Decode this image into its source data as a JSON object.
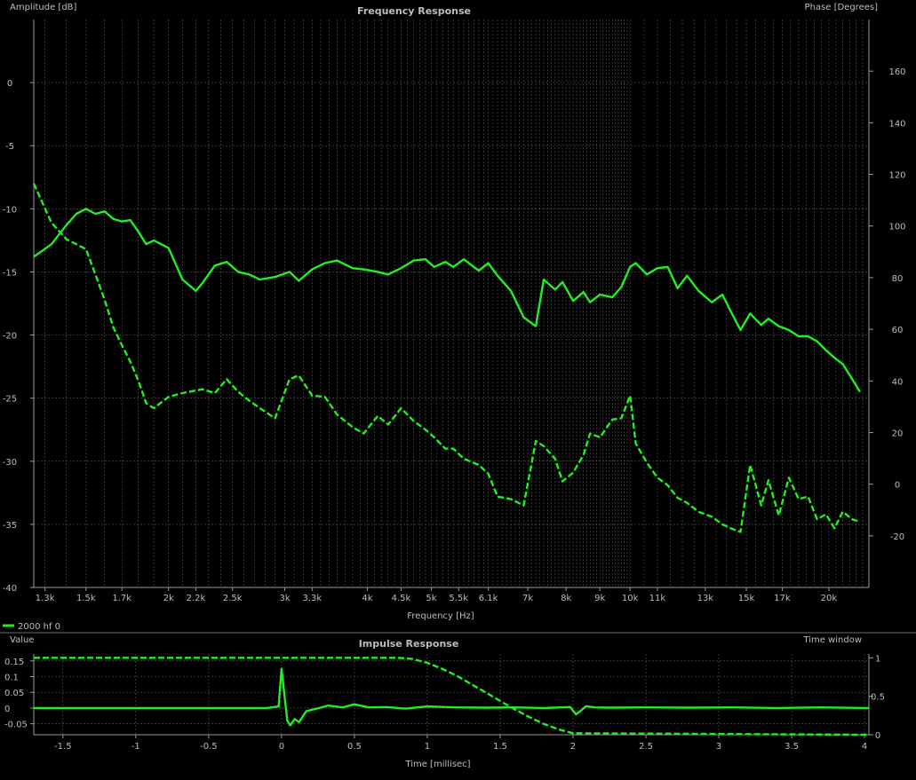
{
  "colors": {
    "background": "#000000",
    "grid": "#5a5a5a",
    "axis": "#9a9a9a",
    "text": "#bdbdbd",
    "trace": "#22ee22"
  },
  "legend": {
    "label": "2000 hf 0"
  },
  "chart_data": [
    {
      "type": "line",
      "title": "Frequency Response",
      "xlabel": "Frequency [Hz]",
      "ylabel": "Amplitude [dB]",
      "y2label": "Phase [Degrees]",
      "x_scale": "log",
      "xlim": [
        1250,
        23000
      ],
      "ylim": [
        -40,
        5
      ],
      "y2lim": [
        -40,
        180
      ],
      "grid": true,
      "legend_position": "bottom-left",
      "x_ticks": [
        {
          "v": 1300,
          "label": "1.3k"
        },
        {
          "v": 1500,
          "label": "1.5k"
        },
        {
          "v": 1700,
          "label": "1.7k"
        },
        {
          "v": 2000,
          "label": "2k"
        },
        {
          "v": 2200,
          "label": "2.2k"
        },
        {
          "v": 2500,
          "label": "2.5k"
        },
        {
          "v": 3000,
          "label": "3k"
        },
        {
          "v": 3300,
          "label": "3.3k"
        },
        {
          "v": 4000,
          "label": "4k"
        },
        {
          "v": 4500,
          "label": "4.5k"
        },
        {
          "v": 5000,
          "label": "5k"
        },
        {
          "v": 5500,
          "label": "5.5k"
        },
        {
          "v": 6100,
          "label": "6.1k"
        },
        {
          "v": 7000,
          "label": "7k"
        },
        {
          "v": 8000,
          "label": "8k"
        },
        {
          "v": 9000,
          "label": "9k"
        },
        {
          "v": 10000,
          "label": "10k"
        },
        {
          "v": 11000,
          "label": "11k"
        },
        {
          "v": 13000,
          "label": "13k"
        },
        {
          "v": 15000,
          "label": "15k"
        },
        {
          "v": 17000,
          "label": "17k"
        },
        {
          "v": 20000,
          "label": "20k"
        }
      ],
      "y_ticks": [
        0,
        -5,
        -10,
        -15,
        -20,
        -25,
        -30,
        -35,
        -40
      ],
      "y2_ticks": [
        160,
        140,
        120,
        100,
        80,
        60,
        40,
        20,
        0,
        -20
      ],
      "series": [
        {
          "axis": "left",
          "style": "solid",
          "x": [
            1250,
            1330,
            1400,
            1450,
            1500,
            1550,
            1600,
            1650,
            1700,
            1750,
            1800,
            1850,
            1900,
            2000,
            2100,
            2200,
            2250,
            2350,
            2450,
            2550,
            2650,
            2750,
            2900,
            3050,
            3150,
            3300,
            3450,
            3600,
            3800,
            3950,
            4150,
            4300,
            4500,
            4700,
            4900,
            5050,
            5250,
            5400,
            5600,
            5900,
            6100,
            6300,
            6600,
            6900,
            7200,
            7400,
            7700,
            7900,
            8200,
            8500,
            8700,
            9000,
            9400,
            9700,
            10000,
            10200,
            10600,
            11000,
            11400,
            11800,
            12200,
            12700,
            13300,
            13800,
            14200,
            14700,
            15200,
            15800,
            16200,
            16800,
            17400,
            18000,
            18600,
            19200,
            19800,
            20400,
            21000,
            21700,
            22300
          ],
          "y": [
            -13.8,
            -12.8,
            -11.3,
            -10.4,
            -10.0,
            -10.4,
            -10.2,
            -10.8,
            -11.0,
            -10.9,
            -11.8,
            -12.8,
            -12.5,
            -13.1,
            -15.6,
            -16.5,
            -15.9,
            -14.5,
            -14.2,
            -15.0,
            -15.2,
            -15.6,
            -15.4,
            -15.0,
            -15.7,
            -14.8,
            -14.3,
            -14.1,
            -14.7,
            -14.8,
            -15.0,
            -15.2,
            -14.7,
            -14.1,
            -14.0,
            -14.6,
            -14.2,
            -14.6,
            -14.0,
            -14.9,
            -14.3,
            -15.3,
            -16.5,
            -18.6,
            -19.3,
            -15.6,
            -16.4,
            -15.8,
            -17.3,
            -16.6,
            -17.4,
            -16.8,
            -17.0,
            -16.2,
            -14.6,
            -14.3,
            -15.2,
            -14.7,
            -14.6,
            -16.3,
            -15.3,
            -16.5,
            -17.4,
            -16.8,
            -18.1,
            -19.6,
            -18.3,
            -19.2,
            -18.7,
            -19.3,
            -19.6,
            -20.1,
            -20.1,
            -20.5,
            -21.2,
            -21.8,
            -22.3,
            -23.5,
            -24.5
          ]
        },
        {
          "axis": "left",
          "style": "dashed",
          "x": [
            1250,
            1330,
            1400,
            1450,
            1500,
            1550,
            1600,
            1650,
            1700,
            1750,
            1800,
            1850,
            1900,
            2000,
            2100,
            2200,
            2250,
            2350,
            2450,
            2550,
            2650,
            2750,
            2900,
            3050,
            3150,
            3300,
            3450,
            3600,
            3800,
            3950,
            4150,
            4300,
            4500,
            4700,
            4900,
            5050,
            5250,
            5400,
            5600,
            5900,
            6100,
            6300,
            6600,
            6900,
            7200,
            7400,
            7700,
            7900,
            8200,
            8500,
            8700,
            9000,
            9400,
            9700,
            10000,
            10200,
            10600,
            11000,
            11400,
            11800,
            12200,
            12700,
            13300,
            13800,
            14200,
            14700,
            15200,
            15800,
            16200,
            16800,
            17400,
            18000,
            18600,
            19200,
            19800,
            20400,
            21000,
            21700,
            22300
          ],
          "y": [
            -8.0,
            -11.1,
            -12.4,
            -12.8,
            -13.2,
            -15.2,
            -17.2,
            -19.4,
            -20.8,
            -22.1,
            -23.6,
            -25.4,
            -25.8,
            -24.9,
            -24.6,
            -24.4,
            -24.3,
            -24.6,
            -23.5,
            -24.5,
            -25.2,
            -25.8,
            -26.6,
            -23.5,
            -23.2,
            -24.8,
            -24.9,
            -26.3,
            -27.3,
            -27.8,
            -26.4,
            -27.1,
            -25.8,
            -26.8,
            -27.5,
            -28.1,
            -29.0,
            -29.0,
            -29.8,
            -30.3,
            -31.0,
            -32.8,
            -33.0,
            -33.5,
            -28.4,
            -28.8,
            -29.8,
            -31.6,
            -30.9,
            -29.5,
            -27.8,
            -28.1,
            -26.7,
            -26.6,
            -24.8,
            -28.6,
            -30.1,
            -31.3,
            -31.9,
            -32.9,
            -33.3,
            -34.0,
            -34.4,
            -35.0,
            -35.3,
            -35.6,
            -30.3,
            -33.5,
            -31.5,
            -34.3,
            -31.3,
            -33.0,
            -32.8,
            -34.6,
            -34.2,
            -35.3,
            -34.0,
            -34.6,
            -34.8
          ]
        }
      ]
    },
    {
      "type": "line",
      "title": "Impulse Response",
      "xlabel": "Time [millisec]",
      "ylabel": "Value",
      "y2label": "Time window",
      "xlim": [
        -1.7,
        4.03
      ],
      "ylim": [
        -0.085,
        0.172
      ],
      "y2lim": [
        0,
        1.05
      ],
      "grid": true,
      "x_ticks": [
        -1.5,
        -1,
        -0.5,
        0,
        0.5,
        1,
        1.5,
        2,
        2.5,
        3,
        3.5,
        4
      ],
      "y_ticks": [
        0.15,
        0.1,
        0.05,
        0,
        -0.05
      ],
      "y2_ticks": [
        1,
        0.5,
        0
      ],
      "series": [
        {
          "axis": "left",
          "style": "solid",
          "x": [
            -1.7,
            -0.1,
            -0.02,
            0.0,
            0.02,
            0.04,
            0.06,
            0.09,
            0.12,
            0.17,
            0.24,
            0.32,
            0.42,
            0.5,
            0.6,
            0.72,
            0.85,
            1.0,
            1.2,
            1.4,
            1.6,
            1.8,
            1.98,
            2.02,
            2.05,
            2.09,
            2.15,
            2.25,
            2.5,
            2.8,
            3.1,
            3.4,
            3.7,
            4.03
          ],
          "y": [
            0,
            0,
            0.005,
            0.125,
            0.04,
            -0.04,
            -0.055,
            -0.035,
            -0.045,
            -0.01,
            -0.002,
            0.008,
            0.002,
            0.012,
            0.002,
            0.003,
            -0.002,
            0.005,
            0.002,
            0.001,
            0.002,
            0,
            0.003,
            -0.02,
            -0.01,
            0.006,
            0.002,
            0.001,
            0.002,
            0.001,
            0.002,
            0,
            0.002,
            0
          ]
        },
        {
          "axis": "right",
          "style": "dashed",
          "x": [
            -1.7,
            0.8,
            0.9,
            1.0,
            1.1,
            1.2,
            1.3,
            1.4,
            1.5,
            1.6,
            1.7,
            1.8,
            1.9,
            2.0,
            4.03
          ],
          "y": [
            1,
            1,
            0.985,
            0.935,
            0.86,
            0.77,
            0.66,
            0.55,
            0.44,
            0.33,
            0.23,
            0.14,
            0.07,
            0.02,
            0
          ]
        }
      ]
    }
  ]
}
